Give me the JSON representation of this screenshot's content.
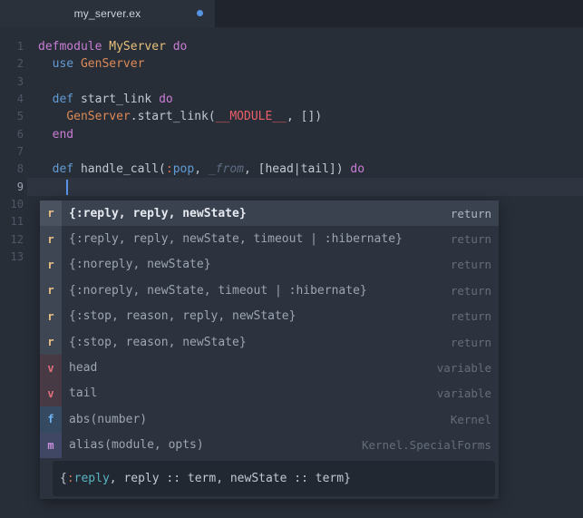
{
  "tab_bar": {
    "active_tab": {
      "title": "my_server.ex",
      "modified": true
    }
  },
  "colors": {
    "editor_background": "#282e38",
    "tab_bar_background": "#20252d",
    "active_tab_background": "#2b313b",
    "modified_dot": "#5693e2",
    "keyword_blue": "#639bd4",
    "keyword_magenta": "#c97dd4",
    "type_yellow": "#e6c07b",
    "module_orange": "#dd8a56",
    "constant_red": "#ec5f67",
    "atom_colon": "#d4704f",
    "teal": "#56b5c1",
    "default_text": "#c1c8d2",
    "popup_background": "#2d333e",
    "popup_selected_row": "#3b424f",
    "cursor": "#5794e6"
  },
  "editor": {
    "line_numbers": [
      1,
      2,
      3,
      4,
      5,
      6,
      7,
      8,
      9,
      10,
      11,
      12,
      13
    ],
    "active_line": 9,
    "lines": [
      {
        "n": 1,
        "tokens": [
          [
            "defmodule",
            "magenta"
          ],
          [
            " ",
            "fg"
          ],
          [
            "MyServer",
            "yellow"
          ],
          [
            " ",
            "fg"
          ],
          [
            "do",
            "magenta"
          ]
        ]
      },
      {
        "n": 2,
        "tokens": [
          [
            "  ",
            "fg"
          ],
          [
            "use",
            "blue"
          ],
          [
            " ",
            "fg"
          ],
          [
            "GenServer",
            "orange"
          ]
        ]
      },
      {
        "n": 3,
        "tokens": []
      },
      {
        "n": 4,
        "tokens": [
          [
            "  ",
            "fg"
          ],
          [
            "def",
            "blue"
          ],
          [
            " ",
            "fg"
          ],
          [
            "start_link",
            "fg"
          ],
          [
            " ",
            "fg"
          ],
          [
            "do",
            "magenta"
          ]
        ]
      },
      {
        "n": 5,
        "tokens": [
          [
            "    ",
            "fg"
          ],
          [
            "GenServer",
            "orange"
          ],
          [
            ".start_link(",
            "fg"
          ],
          [
            "__MODULE__",
            "red"
          ],
          [
            ", [])",
            "fg"
          ]
        ]
      },
      {
        "n": 6,
        "tokens": [
          [
            "  ",
            "fg"
          ],
          [
            "end",
            "magenta"
          ]
        ]
      },
      {
        "n": 7,
        "tokens": []
      },
      {
        "n": 8,
        "tokens": [
          [
            "  ",
            "fg"
          ],
          [
            "def",
            "blue"
          ],
          [
            " ",
            "fg"
          ],
          [
            "handle_call(",
            "fg"
          ],
          [
            ":",
            "colon"
          ],
          [
            "pop",
            "blue"
          ],
          [
            ", ",
            "fg"
          ],
          [
            "_from",
            "param"
          ],
          [
            ", [head|tail]) ",
            "fg"
          ],
          [
            "do",
            "magenta"
          ]
        ]
      },
      {
        "n": 9,
        "tokens": [
          [
            "    ",
            "fg"
          ]
        ]
      }
    ]
  },
  "autocomplete": {
    "items": [
      {
        "icon": "r",
        "label": "{:reply, reply, newState}",
        "annotation": "return",
        "selected": true
      },
      {
        "icon": "r",
        "label": "{:reply, reply, newState, timeout | :hibernate}",
        "annotation": "return",
        "selected": false
      },
      {
        "icon": "r",
        "label": "{:noreply, newState}",
        "annotation": "return",
        "selected": false
      },
      {
        "icon": "r",
        "label": "{:noreply, newState, timeout | :hibernate}",
        "annotation": "return",
        "selected": false
      },
      {
        "icon": "r",
        "label": "{:stop, reason, reply, newState}",
        "annotation": "return",
        "selected": false
      },
      {
        "icon": "r",
        "label": "{:stop, reason, newState}",
        "annotation": "return",
        "selected": false
      },
      {
        "icon": "v",
        "label": "head",
        "annotation": "variable",
        "selected": false
      },
      {
        "icon": "v",
        "label": "tail",
        "annotation": "variable",
        "selected": false
      },
      {
        "icon": "f",
        "label": "abs(number)",
        "annotation": "Kernel",
        "selected": false
      },
      {
        "icon": "m",
        "label": "alias(module, opts)",
        "annotation": "Kernel.SpecialForms",
        "selected": false
      }
    ],
    "description_tokens": [
      [
        "{",
        "fg"
      ],
      [
        ":",
        "colon"
      ],
      [
        "reply",
        "teal"
      ],
      [
        ", reply :: term, newState :: term}",
        "fg"
      ]
    ]
  }
}
